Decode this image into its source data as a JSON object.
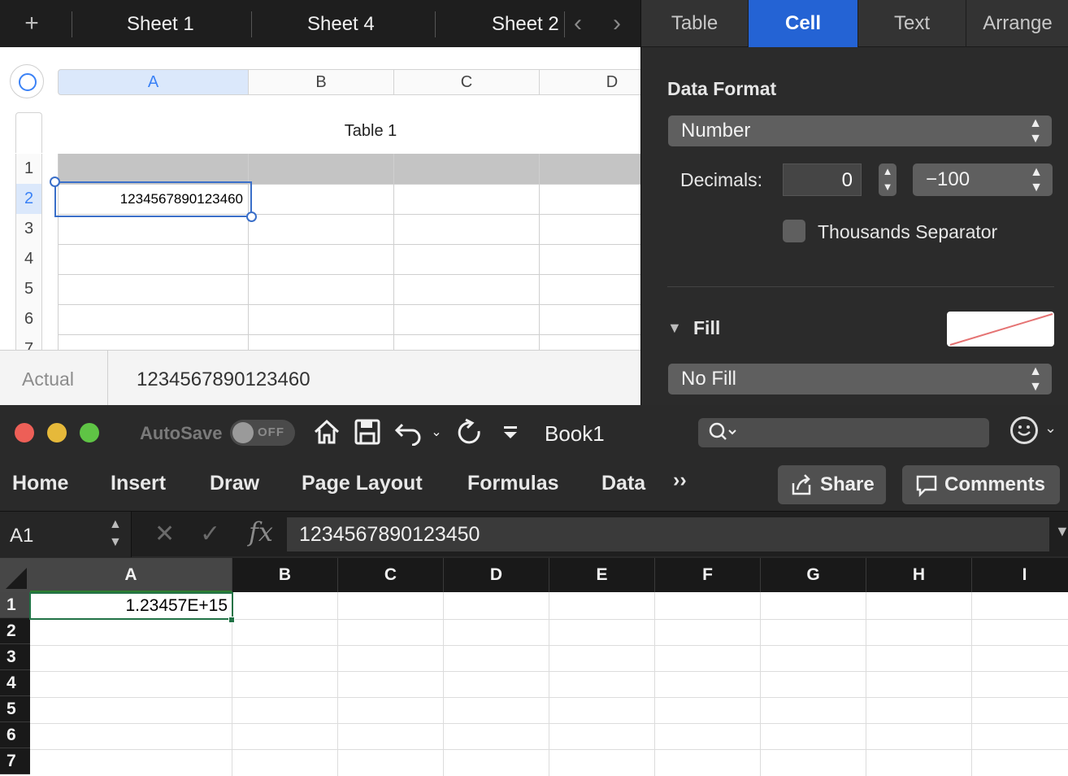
{
  "numbers": {
    "sheet_tabs": {
      "add": "+",
      "tabs": [
        "Sheet 1",
        "Sheet 4",
        "Sheet 2"
      ],
      "prev": "‹",
      "next": "›"
    },
    "inspector_tabs": [
      "Table",
      "Cell",
      "Text",
      "Arrange"
    ],
    "active_inspector_tab": "Cell",
    "table": {
      "title": "Table 1",
      "columns": [
        "A",
        "B",
        "C",
        "D"
      ],
      "rows": [
        "1",
        "2",
        "3",
        "4",
        "5",
        "6",
        "7"
      ],
      "selected_cell_value": "1234567890123460"
    },
    "actual": {
      "label": "Actual",
      "value": "1234567890123460"
    },
    "inspector": {
      "data_format_label": "Data Format",
      "data_format_value": "Number",
      "decimals_label": "Decimals:",
      "decimals_value": "0",
      "negative_format": "−100",
      "thousands_separator_label": "Thousands Separator",
      "fill_label": "Fill",
      "fill_value": "No Fill"
    }
  },
  "excel": {
    "autosave_label": "AutoSave",
    "autosave_state": "OFF",
    "book_title": "Book1",
    "ribbon_tabs": [
      "Home",
      "Insert",
      "Draw",
      "Page Layout",
      "Formulas",
      "Data"
    ],
    "more_tabs": "››",
    "share_label": "Share",
    "comments_label": "Comments",
    "name_box": "A1",
    "fx": "fx",
    "formula_value": "1234567890123450",
    "columns": [
      "A",
      "B",
      "C",
      "D",
      "E",
      "F",
      "G",
      "H",
      "I"
    ],
    "rows": [
      "1",
      "2",
      "3",
      "4",
      "5",
      "6",
      "7"
    ],
    "cell_a1_display": "1.23457E+15"
  }
}
